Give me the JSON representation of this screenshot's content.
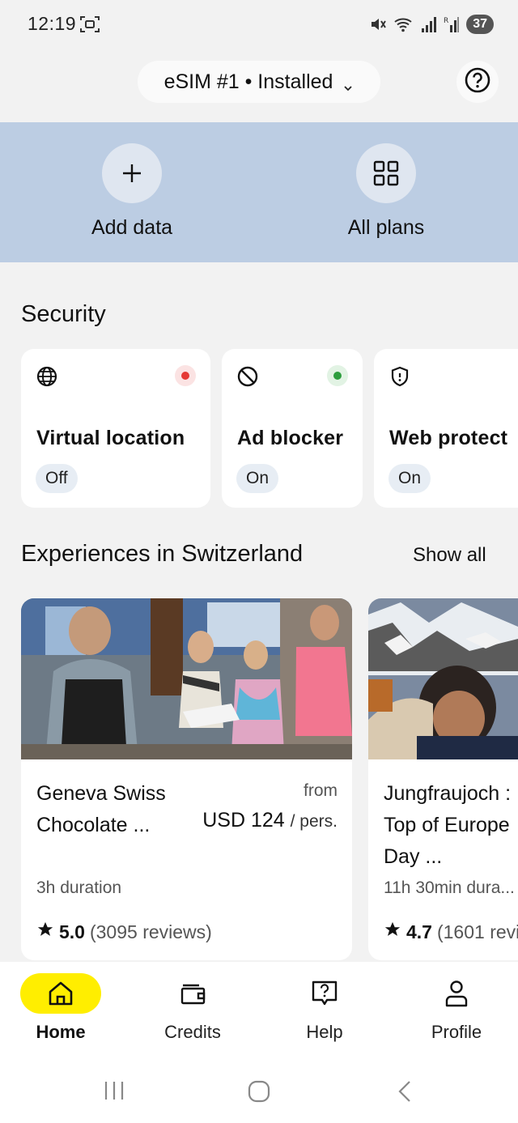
{
  "status_bar": {
    "time": "12:19",
    "battery": "37",
    "icons": [
      "screenshot-icon",
      "mute-icon",
      "wifi-icon",
      "signal-icon",
      "signal-roaming-icon",
      "battery-icon"
    ]
  },
  "header": {
    "esim_selector": "eSIM #1 • Installed",
    "help_icon": "help-circle-icon"
  },
  "actions": [
    {
      "label": "Add data",
      "icon": "plus-icon"
    },
    {
      "label": "All plans",
      "icon": "grid-icon"
    }
  ],
  "security": {
    "title": "Security",
    "cards": [
      {
        "title": "Virtual location",
        "status": "Off",
        "icon": "globe-icon",
        "indicator": "#e53935"
      },
      {
        "title": "Ad blocker",
        "status": "On",
        "icon": "block-icon",
        "indicator": "#2e9e3e"
      },
      {
        "title": "Web protect",
        "status": "On",
        "icon": "shield-icon"
      }
    ]
  },
  "experiences": {
    "title": "Experiences in Switzerland",
    "show_all": "Show all",
    "cards": [
      {
        "name": "Geneva Swiss Chocolate ...",
        "from": "from",
        "price": "USD 124",
        "per": "/ pers.",
        "duration": "3h duration",
        "score": "5.0",
        "reviews": "(3095 reviews)"
      },
      {
        "name": "Jungfraujoch : Top of Europe Day ...",
        "duration": "11h 30min dura...",
        "score": "4.7",
        "reviews": "(1601 revi"
      }
    ]
  },
  "bottom_nav": {
    "items": [
      {
        "label": "Home",
        "icon": "home-icon",
        "active": true
      },
      {
        "label": "Credits",
        "icon": "wallet-icon"
      },
      {
        "label": "Help",
        "icon": "help-chat-icon"
      },
      {
        "label": "Profile",
        "icon": "person-icon"
      }
    ]
  },
  "colors": {
    "accent": "#ffee00",
    "band": "#bccde3",
    "background": "#f2f2f2"
  }
}
